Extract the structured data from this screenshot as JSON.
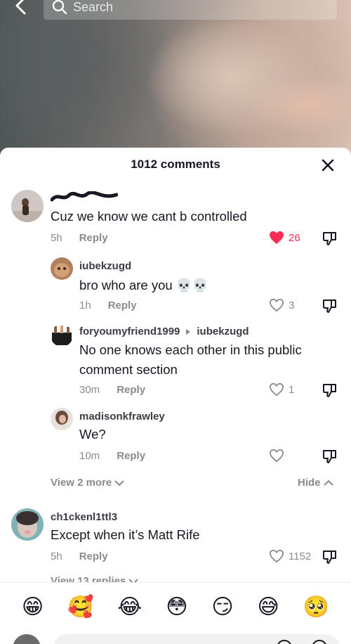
{
  "search": {
    "placeholder": "Search"
  },
  "sheet": {
    "title": "1012 comments"
  },
  "comments": [
    {
      "user": "",
      "text": "Cuz we know we cant b controlled",
      "time": "5h",
      "reply": "Reply",
      "likes": "26",
      "liked": true,
      "replies": [
        {
          "user": "iubekzugd",
          "text": "bro who are you 💀💀",
          "time": "1h",
          "reply": "Reply",
          "likes": "3"
        },
        {
          "user": "foryoumyfriend1999",
          "reply_to": "iubekzugd",
          "text_line1": "No one knows each other in this public",
          "text_line2": "comment section",
          "time": "30m",
          "reply": "Reply",
          "likes": "1"
        },
        {
          "user": "madisonkfrawley",
          "text": "We?",
          "time": "10m",
          "reply": "Reply",
          "likes": ""
        }
      ],
      "view_more": "View 2 more",
      "hide": "Hide"
    },
    {
      "user": "ch1ckenl1ttl3",
      "text": "Except when it’s Matt Rife",
      "time": "5h",
      "reply": "Reply",
      "likes": "1152",
      "view_replies": "View 13 replies"
    }
  ],
  "emoji_bar": [
    "😁",
    "🥰",
    "😂",
    "😳",
    "😏",
    "😅",
    "🥺"
  ],
  "colors": {
    "accent": "#fe2c55",
    "muted": "#8a8b91",
    "text": "#161823"
  }
}
